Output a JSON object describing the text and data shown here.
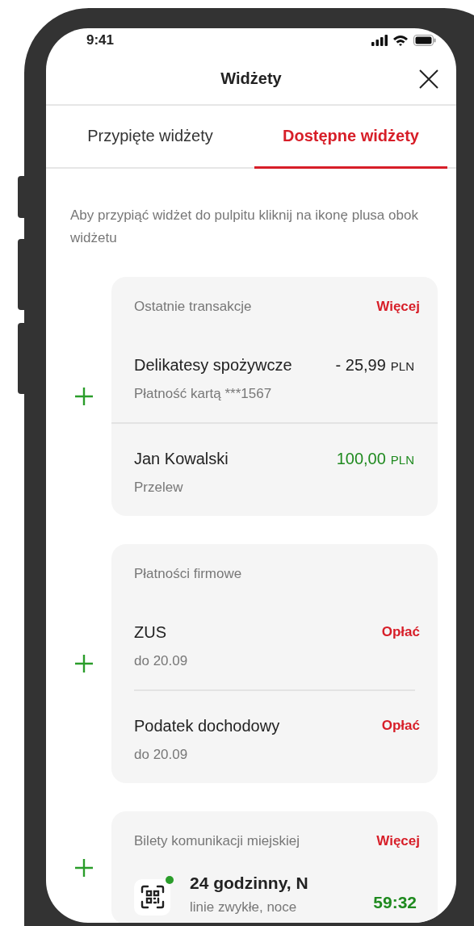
{
  "status_bar": {
    "time": "9:41"
  },
  "header": {
    "title": "Widżety"
  },
  "tabs": [
    {
      "label": "Przypięte widżety",
      "selected": false
    },
    {
      "label": "Dostępne widżety",
      "selected": true
    }
  ],
  "info": "Aby przypiąć widżet do pulpitu kliknij na ikonę plusa obok widżetu",
  "widgets": [
    {
      "kind": "transactions",
      "title": "Ostatnie transakcje",
      "action": "Więcej",
      "rows": [
        {
          "name": "Delikatesy spożywcze",
          "sub": "Płatność kartą ***1567",
          "amount": "- 25,99",
          "currency": "PLN",
          "incoming": false
        },
        {
          "name": "Jan Kowalski",
          "sub": "Przelew",
          "amount": "100,00",
          "currency": "PLN",
          "incoming": true
        }
      ]
    },
    {
      "kind": "payments",
      "title": "Płatności firmowe",
      "rows": [
        {
          "name": "ZUS",
          "sub": "do 20.09",
          "action": "Opłać"
        },
        {
          "name": "Podatek dochodowy",
          "sub": "do 20.09",
          "action": "Opłać"
        }
      ]
    },
    {
      "kind": "tickets",
      "title": "Bilety komunikacji miejskiej",
      "action": "Więcej",
      "rows": [
        {
          "name": "24 godzinny, N",
          "sub": "linie zwykłe, noce",
          "time_left": "59:32",
          "active": true
        }
      ]
    }
  ]
}
